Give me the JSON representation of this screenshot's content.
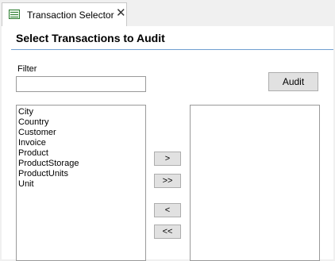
{
  "tab": {
    "title": "Transaction Selector",
    "icon": "table-icon",
    "close_glyph": "✕"
  },
  "heading": "Select Transactions to Audit",
  "filter": {
    "label": "Filter",
    "value": "",
    "placeholder": ""
  },
  "audit_button": "Audit",
  "available_transactions": [
    "City",
    "Country",
    "Customer",
    "Invoice",
    "Product",
    "ProductStorage",
    "ProductUnits",
    "Unit"
  ],
  "selected_transactions": [],
  "move_buttons": {
    "add": ">",
    "add_all": ">>",
    "remove": "<",
    "remove_all": "<<"
  },
  "colors": {
    "accent_rule": "#6f9fd0",
    "tab_icon": "#2e7d32"
  }
}
